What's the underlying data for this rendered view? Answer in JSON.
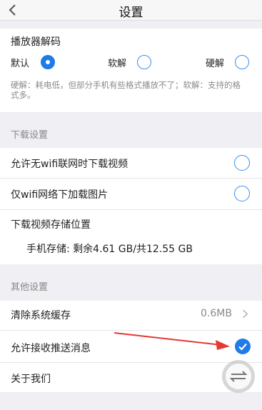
{
  "header": {
    "title": "设置"
  },
  "decoder": {
    "heading": "播放器解码",
    "options": [
      "默认",
      "软解",
      "硬解"
    ],
    "selected": "默认",
    "note": "硬解：耗电低，但部分手机有些格式播放不了；软解：支持的格式多。"
  },
  "download": {
    "section_label": "下载设置",
    "allow_video_label": "允许无wifi联网时下载视频",
    "wifi_images_label": "仅wifi网络下加载图片",
    "storage_heading": "下载视频存储位置",
    "storage_value": "手机存储: 剩余4.61 GB/共12.55 GB"
  },
  "other": {
    "section_label": "其他设置",
    "clear_cache_label": "清除系统缓存",
    "cache_size": "0.6MB",
    "push_label": "允许接收推送消息",
    "about_label": "关于我们"
  },
  "colors": {
    "accent": "#1f7be8",
    "arrow": "#e53935"
  }
}
